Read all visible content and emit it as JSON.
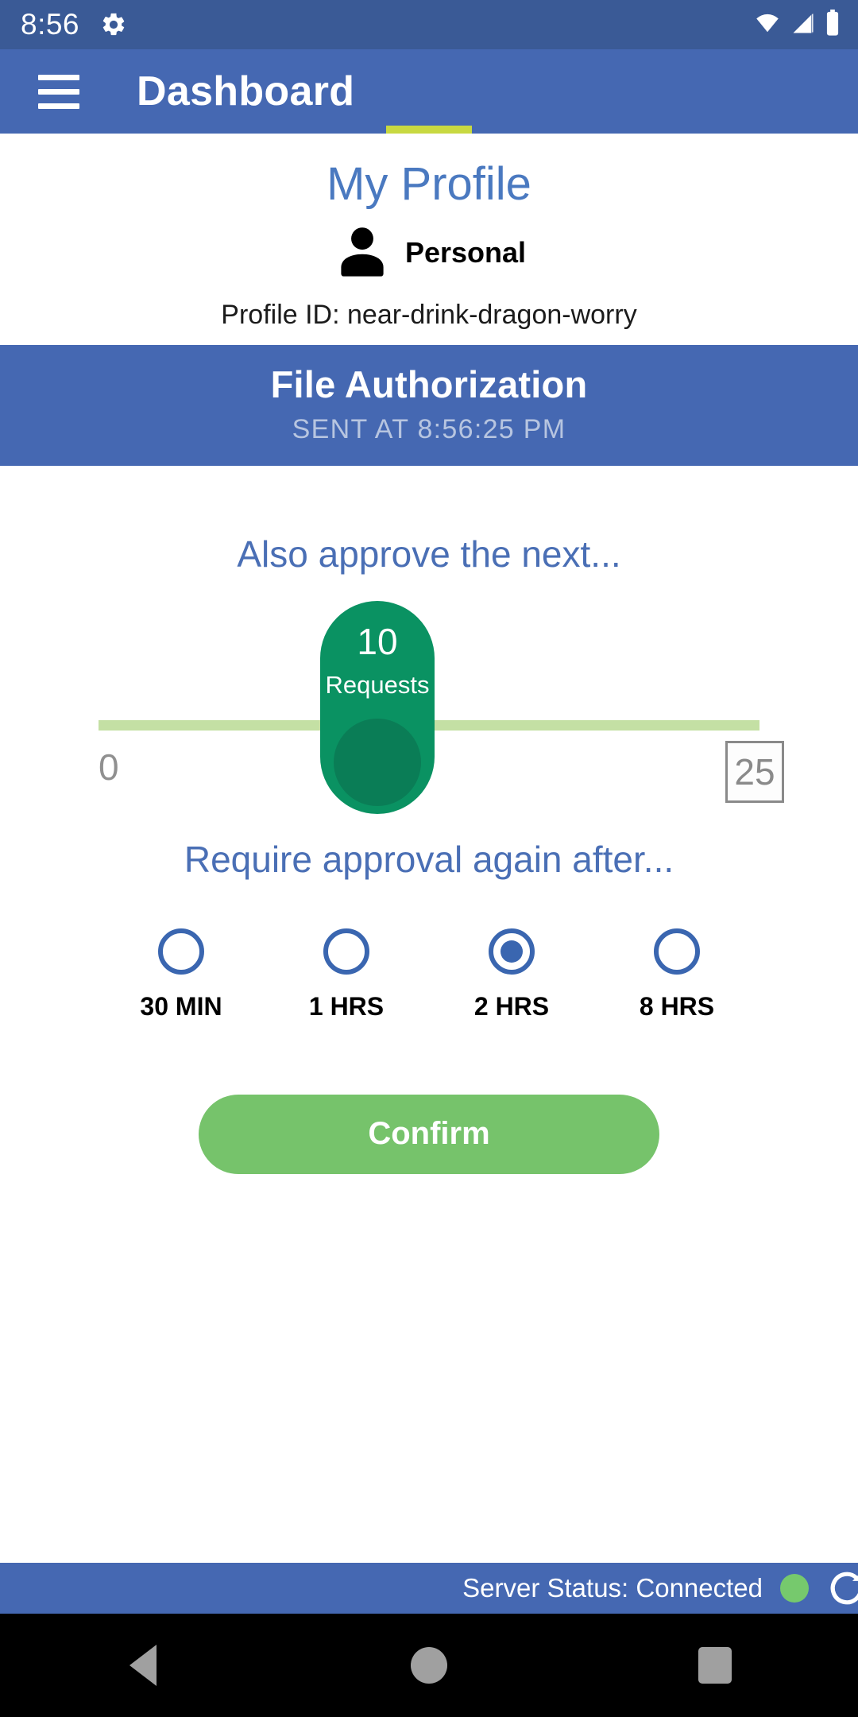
{
  "status_bar": {
    "time": "8:56",
    "gear_icon": "gear-icon",
    "wifi_icon": "wifi-icon",
    "signal_icon": "cellular-signal-icon",
    "battery_icon": "battery-icon"
  },
  "app_bar": {
    "menu_icon": "hamburger-menu-icon",
    "title": "Dashboard",
    "accent_color": "#c8d941",
    "background_color": "#4568b2"
  },
  "profile": {
    "title": "My Profile",
    "avatar_icon": "person-icon",
    "account_name": "Personal",
    "profile_id": "Profile ID: near-drink-dragon-worry"
  },
  "banner": {
    "title": "File Authorization",
    "subtitle": "SENT AT 8:56:25 PM"
  },
  "requests": {
    "label": "Also approve the next...",
    "value": "10",
    "unit": "Requests",
    "min": "0",
    "max": "25",
    "track_color": "#c4e0a4",
    "thumb_color": "#0a9262"
  },
  "interval": {
    "label": "Require approval again after...",
    "options": [
      {
        "label": "30 MIN",
        "selected": false
      },
      {
        "label": "1 HRS",
        "selected": false
      },
      {
        "label": "2 HRS",
        "selected": true
      },
      {
        "label": "8 HRS",
        "selected": false
      }
    ]
  },
  "confirm": {
    "label": "Confirm",
    "color": "#76c36b"
  },
  "footer": {
    "status_text": "Server Status: Connected",
    "status_color": "#76c96d",
    "refresh_icon": "refresh-icon"
  },
  "nav_bar": {
    "back_icon": "back-triangle-icon",
    "home_icon": "home-circle-icon",
    "recents_icon": "recents-square-icon"
  }
}
